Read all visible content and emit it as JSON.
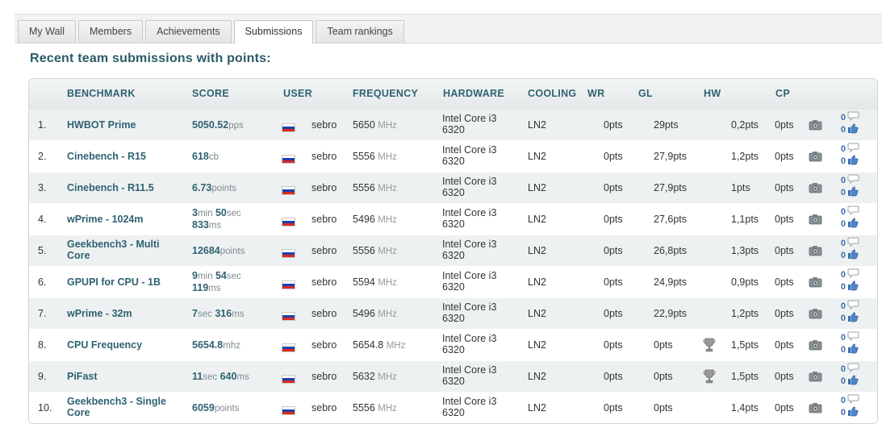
{
  "tabs": [
    {
      "label": "My Wall",
      "active": false
    },
    {
      "label": "Members",
      "active": false
    },
    {
      "label": "Achievements",
      "active": false
    },
    {
      "label": "Submissions",
      "active": true
    },
    {
      "label": "Team rankings",
      "active": false
    }
  ],
  "section_title": "Recent team submissions with points:",
  "columns": {
    "benchmark": "BENCHMARK",
    "score": "SCORE",
    "user": "USER",
    "frequency": "FREQUENCY",
    "hardware": "HARDWARE",
    "cooling": "COOLING",
    "wr": "WR",
    "gl": "GL",
    "hw": "HW",
    "cp": "CP"
  },
  "colors": {
    "accent": "#2f6272",
    "heading": "#2c5b68",
    "row_alt": "#eef1f2",
    "link_blue": "#3a6fb0"
  },
  "icons": {
    "flag": "russia-flag-icon",
    "camera": "camera-icon",
    "comment": "comment-bubble-icon",
    "like": "thumbs-up-icon",
    "trophy": "trophy-icon"
  },
  "rows": [
    {
      "rank": "1.",
      "benchmark": [
        "HWBOT Prime"
      ],
      "score": [
        [
          "5050.52",
          "pps"
        ]
      ],
      "user": "sebro",
      "freq_value": "5650",
      "freq_unit": "MHz",
      "hardware_line1": "Intel Core i3",
      "hardware_line2": "6320",
      "cooling": "LN2",
      "wr": "0pts",
      "gl": "29pts",
      "trophy": false,
      "hw": "0,2pts",
      "cp": "0pts",
      "comments": "0",
      "likes": "0"
    },
    {
      "rank": "2.",
      "benchmark": [
        "Cinebench - R15"
      ],
      "score": [
        [
          "618",
          "cb"
        ]
      ],
      "user": "sebro",
      "freq_value": "5556",
      "freq_unit": "MHz",
      "hardware_line1": "Intel Core i3",
      "hardware_line2": "6320",
      "cooling": "LN2",
      "wr": "0pts",
      "gl": "27,9pts",
      "trophy": false,
      "hw": "1,2pts",
      "cp": "0pts",
      "comments": "0",
      "likes": "0"
    },
    {
      "rank": "3.",
      "benchmark": [
        "Cinebench - R11.5"
      ],
      "score": [
        [
          "6.73",
          "points"
        ]
      ],
      "user": "sebro",
      "freq_value": "5556",
      "freq_unit": "MHz",
      "hardware_line1": "Intel Core i3",
      "hardware_line2": "6320",
      "cooling": "LN2",
      "wr": "0pts",
      "gl": "27,9pts",
      "trophy": false,
      "hw": "1pts",
      "cp": "0pts",
      "comments": "0",
      "likes": "0"
    },
    {
      "rank": "4.",
      "benchmark": [
        "wPrime - 1024m"
      ],
      "score": [
        [
          "3",
          "min"
        ],
        [
          "50",
          "sec"
        ],
        [
          "833",
          "ms"
        ]
      ],
      "score_wrap": true,
      "user": "sebro",
      "freq_value": "5496",
      "freq_unit": "MHz",
      "hardware_line1": "Intel Core i3",
      "hardware_line2": "6320",
      "cooling": "LN2",
      "wr": "0pts",
      "gl": "27,6pts",
      "trophy": false,
      "hw": "1,1pts",
      "cp": "0pts",
      "comments": "0",
      "likes": "0"
    },
    {
      "rank": "5.",
      "benchmark": [
        "Geekbench3 - Multi",
        "Core"
      ],
      "score": [
        [
          "12684",
          "points"
        ]
      ],
      "user": "sebro",
      "freq_value": "5556",
      "freq_unit": "MHz",
      "hardware_line1": "Intel Core i3",
      "hardware_line2": "6320",
      "cooling": "LN2",
      "wr": "0pts",
      "gl": "26,8pts",
      "trophy": false,
      "hw": "1,3pts",
      "cp": "0pts",
      "comments": "0",
      "likes": "0"
    },
    {
      "rank": "6.",
      "benchmark": [
        "GPUPI for CPU - 1B"
      ],
      "score": [
        [
          "9",
          "min"
        ],
        [
          "54",
          "sec"
        ],
        [
          "119",
          "ms"
        ]
      ],
      "score_wrap": true,
      "user": "sebro",
      "freq_value": "5594",
      "freq_unit": "MHz",
      "hardware_line1": "Intel Core i3",
      "hardware_line2": "6320",
      "cooling": "LN2",
      "wr": "0pts",
      "gl": "24,9pts",
      "trophy": false,
      "hw": "0,9pts",
      "cp": "0pts",
      "comments": "0",
      "likes": "0"
    },
    {
      "rank": "7.",
      "benchmark": [
        "wPrime - 32m"
      ],
      "score": [
        [
          "7",
          "sec"
        ],
        [
          "316",
          "ms"
        ]
      ],
      "user": "sebro",
      "freq_value": "5496",
      "freq_unit": "MHz",
      "hardware_line1": "Intel Core i3",
      "hardware_line2": "6320",
      "cooling": "LN2",
      "wr": "0pts",
      "gl": "22,9pts",
      "trophy": false,
      "hw": "1,2pts",
      "cp": "0pts",
      "comments": "0",
      "likes": "0"
    },
    {
      "rank": "8.",
      "benchmark": [
        "CPU Frequency"
      ],
      "score": [
        [
          "5654.8",
          "mhz"
        ]
      ],
      "user": "sebro",
      "freq_value": "5654.8",
      "freq_unit": "MHz",
      "hardware_line1": "Intel Core i3",
      "hardware_line2": "6320",
      "cooling": "LN2",
      "wr": "0pts",
      "gl": "0pts",
      "trophy": true,
      "hw": "1,5pts",
      "cp": "0pts",
      "comments": "0",
      "likes": "0"
    },
    {
      "rank": "9.",
      "benchmark": [
        "PiFast"
      ],
      "score": [
        [
          "11",
          "sec"
        ],
        [
          "640",
          "ms"
        ]
      ],
      "user": "sebro",
      "freq_value": "5632",
      "freq_unit": "MHz",
      "hardware_line1": "Intel Core i3",
      "hardware_line2": "6320",
      "cooling": "LN2",
      "wr": "0pts",
      "gl": "0pts",
      "trophy": true,
      "hw": "1,5pts",
      "cp": "0pts",
      "comments": "0",
      "likes": "0"
    },
    {
      "rank": "10.",
      "benchmark": [
        "Geekbench3 - Single",
        "Core"
      ],
      "score": [
        [
          "6059",
          "points"
        ]
      ],
      "user": "sebro",
      "freq_value": "5556",
      "freq_unit": "MHz",
      "hardware_line1": "Intel Core i3",
      "hardware_line2": "6320",
      "cooling": "LN2",
      "wr": "0pts",
      "gl": "0pts",
      "trophy": false,
      "hw": "1,4pts",
      "cp": "0pts",
      "comments": "0",
      "likes": "0"
    }
  ]
}
